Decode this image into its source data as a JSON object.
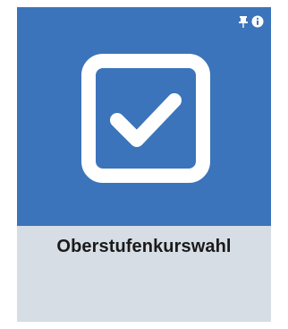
{
  "tile": {
    "label": "Oberstufenkurswahl",
    "icon": "checkbox-checked-icon",
    "top_icons": [
      "pin-icon",
      "info-icon"
    ]
  },
  "colors": {
    "tile_top": "#3b74ba",
    "tile_bottom": "#d6dde5",
    "icon": "#ffffff",
    "label": "#1a1a1a"
  }
}
